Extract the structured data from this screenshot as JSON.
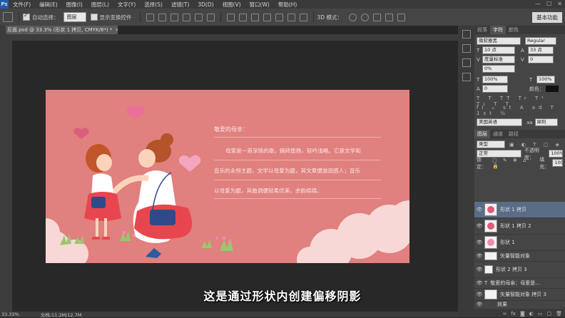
{
  "menu": [
    "文件(F)",
    "编辑(E)",
    "图像(I)",
    "图层(L)",
    "文字(Y)",
    "选择(S)",
    "滤镜(T)",
    "3D(D)",
    "视图(V)",
    "窗口(W)",
    "帮助(H)"
  ],
  "app_logo": "Ps",
  "window_controls": [
    "—",
    "☐",
    "✕"
  ],
  "options": {
    "auto_select_label": "自动选择：",
    "auto_select_value": "图层",
    "show_transform": "显示变换控件",
    "mode3d": "3D 模式：",
    "workspace": "基本功能"
  },
  "document": {
    "tab_title": "反面.psd @ 33.3% (形状 1 拷贝, CMYK/8*) *",
    "close": "×",
    "zoom": "33.33%",
    "doc_info": "文档:11.2M/12.7M"
  },
  "artwork": {
    "greeting": "敬爱的母亲：",
    "lines": [
      "母爱是一首深情的歌，婉转悠扬，轻吟浅唱。它是文学和",
      "音乐的永恒主题，文学以母爱为题，其文章便滋润感人；音乐",
      "以母爱为题，其曲调便轻柔优美，余韵绵绵。"
    ]
  },
  "subtitle": "这是通过形状内创建偏移阴影",
  "char_panel": {
    "tabs": [
      "段落",
      "字符",
      "颜色"
    ],
    "font": "微软雅黑",
    "style": "Regular",
    "size": "10 点",
    "leading": "33 点",
    "kerning": "度量标准",
    "tracking": "0",
    "vscale": "100%",
    "hscale": "100%",
    "baseline": "0%",
    "color_label": "颜色：",
    "lang": "美国英语",
    "aa": "犀利"
  },
  "layers_panel": {
    "tabs": [
      "图层",
      "通道",
      "路径"
    ],
    "kind": "类型",
    "blend": "正常",
    "opacity_label": "不透明度：",
    "opacity": "100%",
    "lock_label": "锁定：",
    "fill_label": "填充：",
    "fill": "100%",
    "layers": [
      "形状 1 拷贝",
      "形状 1 拷贝 2",
      "形状 1",
      "矢量智能对象",
      "形状 2 拷贝 3",
      "敬爱的母亲：母爱是...",
      "矢量智能对象 拷贝 3",
      "效果"
    ]
  },
  "colors": {
    "art_bg": "#e0807f",
    "heart": "#ec6f98",
    "cloud": "#f8d8d6"
  }
}
